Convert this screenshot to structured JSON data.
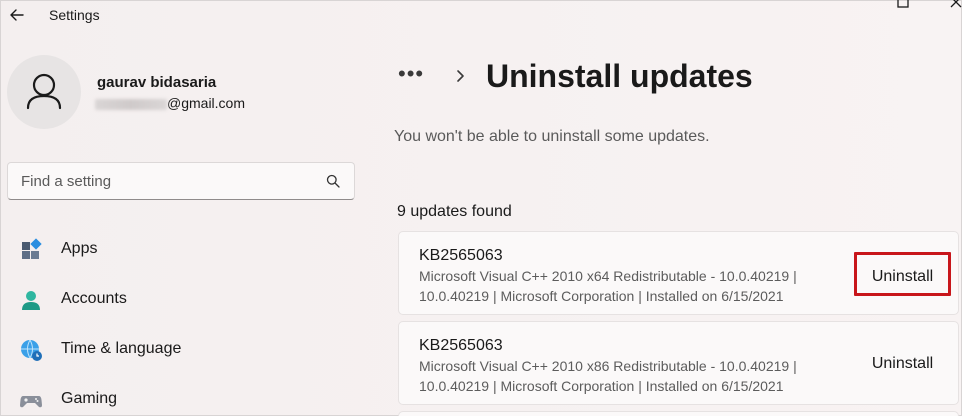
{
  "window": {
    "app_title": "Settings"
  },
  "profile": {
    "name": "gaurav bidasaria",
    "email_visible": "@gmail.com"
  },
  "search": {
    "placeholder": "Find a setting"
  },
  "sidebar": {
    "items": [
      {
        "label": "Apps",
        "icon": "apps-icon"
      },
      {
        "label": "Accounts",
        "icon": "accounts-icon"
      },
      {
        "label": "Time & language",
        "icon": "globe-clock-icon"
      },
      {
        "label": "Gaming",
        "icon": "gamepad-icon"
      }
    ]
  },
  "main": {
    "breadcrumb_more": "•••",
    "title": "Uninstall updates",
    "subtitle": "You won't be able to uninstall some updates.",
    "count": "9 updates found",
    "updates": [
      {
        "kb": "KB2565063",
        "line1": "Microsoft Visual C++ 2010  x64 Redistributable - 10.0.40219  |",
        "line2": "10.0.40219  |  Microsoft Corporation  |  Installed on 6/15/2021",
        "button": "Uninstall",
        "highlighted": true
      },
      {
        "kb": "KB2565063",
        "line1": "Microsoft Visual C++ 2010  x86 Redistributable - 10.0.40219  |",
        "line2": "10.0.40219  |  Microsoft Corporation  |  Installed on 6/15/2021",
        "button": "Uninstall",
        "highlighted": false
      }
    ]
  },
  "colors": {
    "highlight_border": "#c8161b",
    "accent": "#0067c0"
  }
}
